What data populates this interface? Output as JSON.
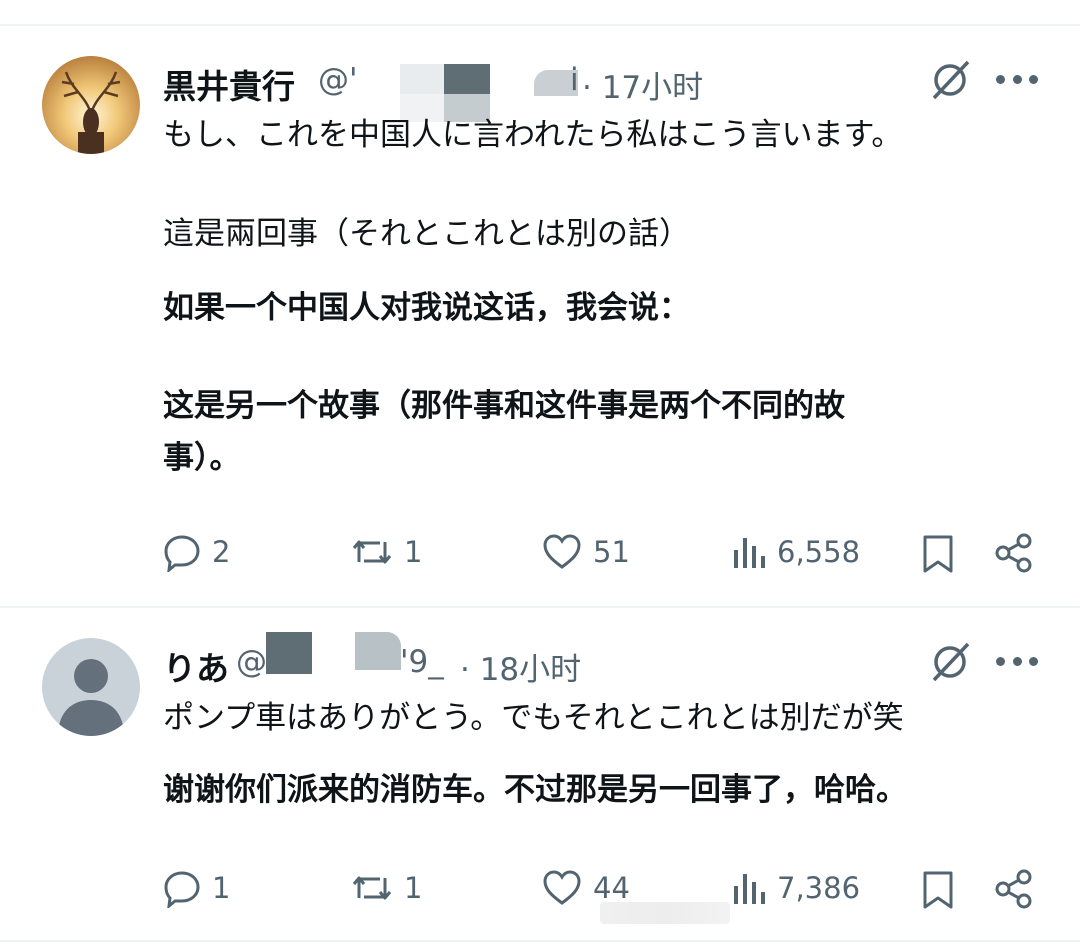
{
  "posts": [
    {
      "display_name": "黒井貴行",
      "handle_start": "@'",
      "handle_end": "i",
      "time": "· 17小时",
      "lines": [
        "もし、これを中国人に言われたら私はこう言います。",
        "這是兩回事（それとこれとは別の話）"
      ],
      "translation_lines": [
        "如果一个中国人对我说这话，我会说：",
        "这是另一个故事（那件事和这件事是两个不同的故",
        "事）。"
      ],
      "stats": {
        "replies": "2",
        "reposts": "1",
        "likes": "51",
        "views": "6,558"
      }
    },
    {
      "display_name": "りあ",
      "handle_start": "@",
      "handle_end": "'9_",
      "time": "· 18小时",
      "lines": [
        "ポンプ車はありがとう。でもそれとこれとは別だが笑"
      ],
      "translation_lines": [
        "谢谢你们派来的消防车。不过那是另一回事了，哈哈。"
      ],
      "stats": {
        "replies": "1",
        "reposts": "1",
        "likes": "44",
        "views": "7,386"
      }
    }
  ],
  "icons": {
    "reply": "reply-icon",
    "repost": "repost-icon",
    "like": "heart-icon",
    "views": "views-icon",
    "bookmark": "bookmark-icon",
    "share": "share-icon",
    "grok": "grok-icon",
    "more": "more-icon"
  },
  "colors": {
    "text": "#0f1419",
    "secondary": "#536471",
    "divider": "#eff3f4",
    "redaction": "#5f6d75"
  }
}
